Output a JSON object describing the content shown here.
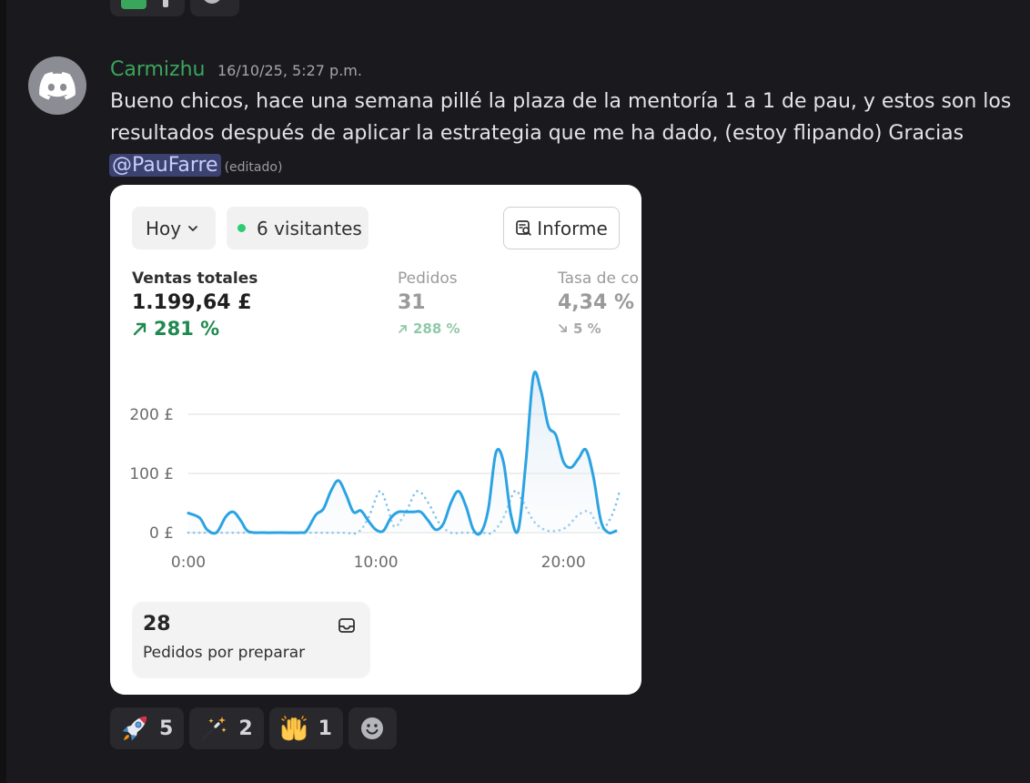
{
  "message": {
    "username": "Carmizhu",
    "timestamp": "16/10/25, 5:27 p.m.",
    "line1": "Bueno chicos, hace una semana pillé la plaza de la mentoría 1 a 1 de pau, y estos son los",
    "line2": "resultados después de aplicar la estrategia que me ha dado, (estoy flipando) Gracias",
    "mention": "@PauFarre",
    "edited": "(editado)"
  },
  "embed": {
    "period": "Hoy",
    "visitors": "6 visitantes",
    "report_button": "Informe",
    "metrics": [
      {
        "label": "Ventas totales",
        "value": "1.199,64 £",
        "delta": "281 %"
      },
      {
        "label": "Pedidos",
        "value": "31",
        "delta": "288 %"
      },
      {
        "label": "Tasa de co",
        "value": "4,34 %",
        "delta": "5 %"
      }
    ],
    "orders_to_prepare": {
      "count": "28",
      "label": "Pedidos por preparar"
    }
  },
  "chart_data": {
    "type": "line",
    "y_tick_labels": [
      "200 £",
      "100 £",
      "0 £"
    ],
    "x_tick_labels": [
      "0:00",
      "10:00",
      "20:00"
    ],
    "ylim": [
      0,
      250
    ],
    "xlim": [
      0,
      23
    ],
    "series": [
      {
        "style": "solid",
        "color": "#2ba3e3",
        "x": [
          0,
          0.6,
          1.0,
          1.5,
          2.0,
          2.4,
          2.8,
          3.2,
          4,
          5,
          6,
          6.3,
          6.8,
          7.2,
          7.6,
          8.0,
          8.4,
          8.8,
          9.2,
          9.6,
          10.0,
          10.4,
          10.8,
          11.2,
          11.6,
          12.0,
          12.4,
          12.8,
          13.2,
          13.6,
          14.0,
          14.4,
          14.8,
          15.2,
          15.6,
          16.0,
          16.4,
          16.8,
          17.2,
          17.6,
          18.0,
          18.4,
          18.8,
          19.2,
          19.6,
          20.0,
          20.4,
          20.8,
          21.2,
          21.6,
          22.0,
          22.4,
          22.8
        ],
        "y": [
          33,
          25,
          5,
          0,
          27,
          35,
          20,
          2,
          0,
          0,
          0,
          3,
          30,
          40,
          70,
          88,
          65,
          35,
          37,
          20,
          5,
          3,
          25,
          35,
          35,
          35,
          35,
          20,
          5,
          15,
          50,
          70,
          45,
          5,
          0,
          40,
          135,
          120,
          30,
          5,
          120,
          265,
          240,
          180,
          165,
          120,
          110,
          125,
          140,
          95,
          20,
          0,
          3
        ]
      },
      {
        "style": "dotted",
        "color": "#7fc3ea",
        "x": [
          0,
          4,
          8,
          9,
          9.6,
          10.2,
          10.6,
          11.0,
          11.6,
          12.2,
          12.8,
          13.4,
          14.0,
          14.6,
          15.6,
          16.2,
          16.8,
          17.4,
          17.8,
          18.4,
          19.0,
          19.6,
          20.2,
          20.8,
          21.4,
          22.0,
          22.6,
          23
        ],
        "y": [
          0,
          0,
          0,
          0,
          25,
          70,
          45,
          10,
          35,
          70,
          50,
          15,
          0,
          0,
          0,
          0,
          25,
          70,
          55,
          20,
          5,
          3,
          10,
          30,
          35,
          5,
          30,
          70
        ]
      }
    ]
  }
}
